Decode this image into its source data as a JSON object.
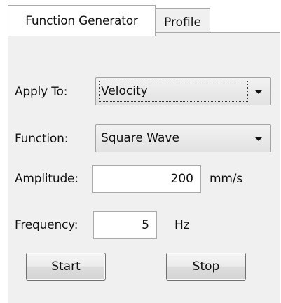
{
  "tabs": {
    "function_generator": "Function Generator",
    "profile": "Profile"
  },
  "apply_to": {
    "label": "Apply To:",
    "selected": "Velocity"
  },
  "function": {
    "label": "Function:",
    "selected": "Square Wave"
  },
  "amplitude": {
    "label": "Amplitude:",
    "value": "200",
    "unit": "mm/s"
  },
  "frequency": {
    "label": "Frequency:",
    "value": "5",
    "unit": "Hz"
  },
  "buttons": {
    "start": "Start",
    "stop": "Stop"
  }
}
